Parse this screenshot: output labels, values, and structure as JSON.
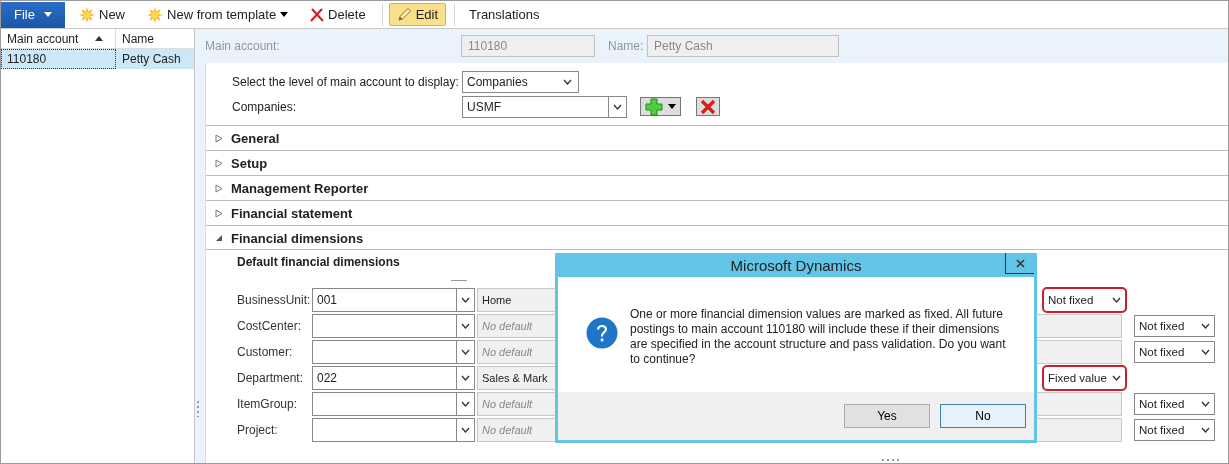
{
  "toolbar": [
    {
      "label": "File",
      "kind": "menu",
      "active": false
    },
    {
      "label": "New",
      "kind": "new",
      "active": false
    },
    {
      "label": "New from template",
      "kind": "template",
      "active": false
    },
    {
      "label": "Delete",
      "kind": "delete",
      "active": false
    },
    {
      "label": "Edit",
      "kind": "edit",
      "active": true
    },
    {
      "label": "Translations",
      "kind": "plain",
      "active": false
    }
  ],
  "list": {
    "columns": [
      {
        "label": "Main account",
        "sorted": true
      },
      {
        "label": "Name",
        "sorted": false
      }
    ],
    "rows": [
      {
        "cells": [
          "110180",
          "Petty Cash"
        ],
        "selected": true
      }
    ]
  },
  "header": {
    "main_account_label": "Main account:",
    "main_account": "110180",
    "name_label": "Name:",
    "name": "Petty Cash"
  },
  "level": {
    "label": "Select the level of main account to display:",
    "value": "Companies"
  },
  "companies": {
    "label": "Companies:",
    "value": "USMF"
  },
  "fasttabs": [
    {
      "title": "General",
      "expanded": false
    },
    {
      "title": "Setup",
      "expanded": false
    },
    {
      "title": "Management Reporter",
      "expanded": false
    },
    {
      "title": "Financial statement",
      "expanded": false
    },
    {
      "title": "Financial dimensions",
      "expanded": true
    }
  ],
  "dimensions": {
    "title": "Default financial dimensions",
    "rows": [
      {
        "label": "BusinessUnit:",
        "value": "001",
        "description": "Home",
        "fixed": "Not fixed",
        "highlighted": true
      },
      {
        "label": "CostCenter:",
        "value": "",
        "placeholder": "No default",
        "fixed": "Not fixed",
        "highlighted": false
      },
      {
        "label": "Customer:",
        "value": "",
        "placeholder": "No default",
        "fixed": "Not fixed",
        "highlighted": false
      },
      {
        "label": "Department:",
        "value": "022",
        "description": "Sales & Mark",
        "fixed": "Fixed value",
        "highlighted": true
      },
      {
        "label": "ItemGroup:",
        "value": "",
        "placeholder": "No default",
        "fixed": "Not fixed",
        "highlighted": false
      },
      {
        "label": "Project:",
        "value": "",
        "placeholder": "No default",
        "fixed": "Not fixed",
        "highlighted": false
      }
    ]
  },
  "dialog": {
    "title": "Microsoft Dynamics",
    "message": "One or more financial dimension values are marked as fixed. All future postings to main account 110180 will include these if their dimensions are specified in the account structure and pass validation. Do you want to continue?",
    "buttons": [
      {
        "label": "Yes",
        "focused": false
      },
      {
        "label": "No",
        "focused": true
      }
    ]
  }
}
